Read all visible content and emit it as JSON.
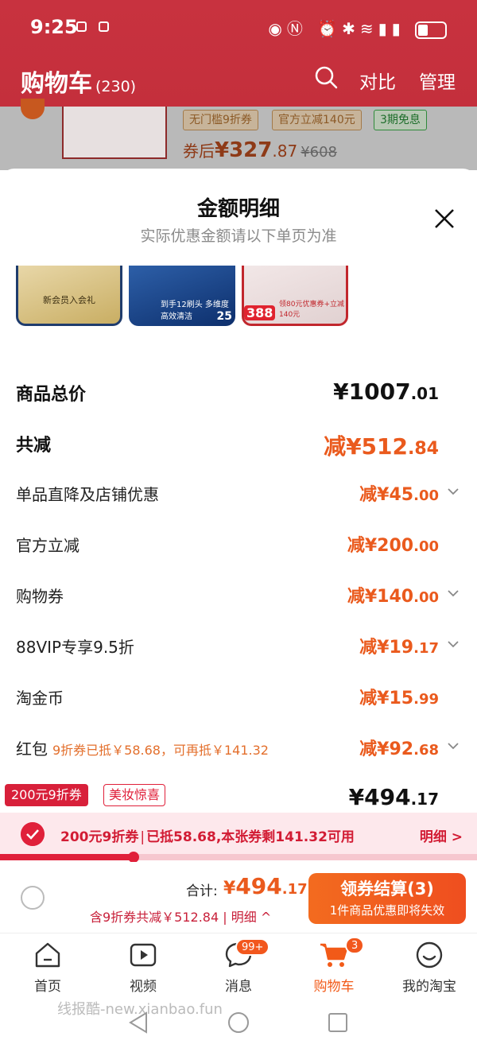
{
  "status_bar": {
    "time": "9:25"
  },
  "header": {
    "title": "购物车",
    "count": "(230)",
    "compare": "对比",
    "manage": "管理"
  },
  "bg_item": {
    "tags": [
      "无门槛9折券",
      "官方立减140元",
      "3期免息"
    ],
    "price_prefix": "券后",
    "price_int": "¥327",
    "price_cents": ".87",
    "price_orig": "¥608"
  },
  "sheet": {
    "title": "金额明细",
    "subtitle": "实际优惠金额请以下单页为准",
    "thumbs": [
      {
        "caption": "新会员入会礼"
      },
      {
        "caption": "到手12刷头 多维度高效清洁",
        "num": "25"
      },
      {
        "badge": "388",
        "caption": "领80元优惠券+立减140元"
      }
    ]
  },
  "breakdown": {
    "total": {
      "label": "商品总价",
      "int": "¥1007",
      "cents": ".01"
    },
    "reduce_total": {
      "label": "共减",
      "int": "减¥512",
      "cents": ".84"
    },
    "items": [
      {
        "label": "单品直降及店铺优惠",
        "int": "减¥45",
        "cents": ".00",
        "chevron": true
      },
      {
        "label": "官方立减",
        "int": "减¥200",
        "cents": ".00",
        "chevron": false
      },
      {
        "label": "购物券",
        "int": "减¥140",
        "cents": ".00",
        "chevron": true
      },
      {
        "label": "88VIP专享9.5折",
        "int": "减¥19",
        "cents": ".17",
        "chevron": true
      },
      {
        "label": "淘金币",
        "int": "减¥15",
        "cents": ".99",
        "chevron": false
      },
      {
        "label": "红包",
        "note": "9折券已抵￥58.68，可再抵￥141.32",
        "int": "减¥92",
        "cents": ".68",
        "chevron": true
      }
    ],
    "final": {
      "int": "¥494",
      "cents": ".17"
    }
  },
  "promo_tags": {
    "red": "200元9折券",
    "outline": "美妆惊喜"
  },
  "coupon_bar": {
    "name": "200元9折券",
    "sep": "|",
    "text": "已抵58.68,本张券剩141.32可用",
    "detail": "明细 >",
    "progress_fraction": 0.28
  },
  "footer": {
    "total_label": "合计:",
    "total_prefix": "¥",
    "total_int": "494",
    "total_cents": ".17",
    "sub": "含9折券共减￥512.84 | 明细 ^",
    "checkout_l1": "领券结算(3)",
    "checkout_l2": "1件商品优惠即将失效"
  },
  "tabs": [
    {
      "label": "首页",
      "icon": "home-icon"
    },
    {
      "label": "视频",
      "icon": "video-icon"
    },
    {
      "label": "消息",
      "icon": "message-icon",
      "badge": "99+"
    },
    {
      "label": "购物车",
      "icon": "cart-icon",
      "badge": "3",
      "active": true
    },
    {
      "label": "我的淘宝",
      "icon": "profile-icon"
    }
  ],
  "watermark": "线报酷-new.xianbao.fun",
  "colors": {
    "accent": "#ea5a1d",
    "brand_red": "#c8323f",
    "coupon_red": "#e0203a"
  }
}
